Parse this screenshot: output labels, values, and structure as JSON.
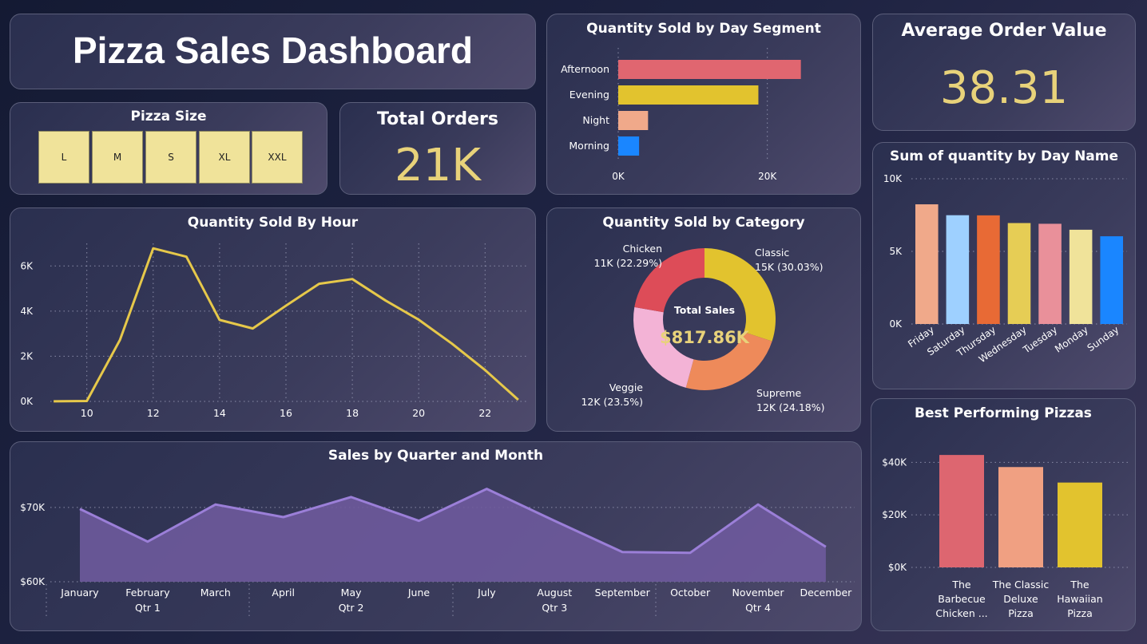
{
  "title": "Pizza Sales Dashboard",
  "colors": {
    "yellow": "#e6c84a",
    "purple": "#9b7fd8",
    "kpi": "#e8d27a"
  },
  "pizza_size": {
    "title": "Pizza Size",
    "options": [
      "L",
      "M",
      "S",
      "XL",
      "XXL"
    ]
  },
  "total_orders": {
    "title": "Total Orders",
    "value": "21K"
  },
  "avg_order": {
    "title": "Average Order Value",
    "value": "38.31"
  },
  "chart_data": [
    {
      "id": "day_segment",
      "type": "bar",
      "orientation": "horizontal",
      "title": "Quantity Sold by Day Segment",
      "categories": [
        "Afternoon",
        "Evening",
        "Night",
        "Morning"
      ],
      "values": [
        24500,
        18800,
        4000,
        2800
      ],
      "colors": [
        "#e06670",
        "#e2c32e",
        "#f0a98a",
        "#1a86ff"
      ],
      "xlim": [
        0,
        30000
      ],
      "ticks": [
        0,
        20000
      ],
      "tick_labels": [
        "0K",
        "20K"
      ],
      "grid": true
    },
    {
      "id": "by_hour",
      "type": "line",
      "title": "Quantity Sold By Hour",
      "x": [
        9,
        10,
        11,
        12,
        13,
        14,
        15,
        16,
        17,
        18,
        19,
        20,
        21,
        22,
        23
      ],
      "values": [
        4,
        18,
        2730,
        6780,
        6410,
        3610,
        3230,
        4240,
        5210,
        5420,
        4470,
        3620,
        2560,
        1390,
        70
      ],
      "xlim": [
        8.9,
        23.1
      ],
      "ylim": [
        0,
        7000
      ],
      "xticks": [
        10,
        12,
        14,
        16,
        18,
        20,
        22
      ],
      "yticks": [
        0,
        2000,
        4000,
        6000
      ],
      "ytick_labels": [
        "0K",
        "2K",
        "4K",
        "6K"
      ],
      "grid": true
    },
    {
      "id": "category",
      "type": "pie",
      "title": "Quantity Sold by Category",
      "center_label": "Total Sales",
      "center_value": "$817.86K",
      "slices": [
        {
          "name": "Classic",
          "value": 30.03,
          "label": "15K (30.03%)",
          "color": "#e2c32e"
        },
        {
          "name": "Supreme",
          "value": 24.18,
          "label": "12K (24.18%)",
          "color": "#ee8a5a"
        },
        {
          "name": "Veggie",
          "value": 23.5,
          "label": "12K (23.5%)",
          "color": "#f3b3d6"
        },
        {
          "name": "Chicken",
          "value": 22.29,
          "label": "11K (22.29%)",
          "color": "#dd4c58"
        }
      ]
    },
    {
      "id": "day_name",
      "type": "bar",
      "title": "Sum of quantity by Day Name",
      "categories": [
        "Friday",
        "Saturday",
        "Thursday",
        "Wednesday",
        "Tuesday",
        "Monday",
        "Sunday"
      ],
      "values": [
        8240,
        7490,
        7480,
        6950,
        6900,
        6490,
        6040
      ],
      "colors": [
        "#f0a98a",
        "#9ed0ff",
        "#e86a35",
        "#e6cd55",
        "#e9909a",
        "#f0e39a",
        "#1a86ff"
      ],
      "ylim": [
        0,
        10000
      ],
      "yticks": [
        0,
        5000,
        10000
      ],
      "ytick_labels": [
        "0K",
        "5K",
        "10K"
      ],
      "grid": true
    },
    {
      "id": "best_pizzas",
      "type": "bar",
      "title": "Best Performing Pizzas",
      "categories": [
        "The Barbecue Chicken ...",
        "The Classic Deluxe Pizza",
        "The Hawaiian Pizza"
      ],
      "category_lines": [
        [
          "The",
          "Barbecue",
          "Chicken ..."
        ],
        [
          "The Classic",
          "Deluxe",
          "Pizza"
        ],
        [
          "The",
          "Hawaiian",
          "Pizza"
        ]
      ],
      "values": [
        42800,
        38200,
        32300
      ],
      "colors": [
        "#dd6670",
        "#f0a082",
        "#e2c32e"
      ],
      "ylim": [
        0,
        48000
      ],
      "yticks": [
        0,
        20000,
        40000
      ],
      "ytick_labels": [
        "$0K",
        "$20K",
        "$40K"
      ],
      "grid": true
    },
    {
      "id": "quarter_month",
      "type": "area",
      "title": "Sales by Quarter and Month",
      "categories": [
        "January",
        "February",
        "March",
        "April",
        "May",
        "June",
        "July",
        "August",
        "September",
        "October",
        "November",
        "December"
      ],
      "values": [
        69800,
        65400,
        70400,
        68700,
        71400,
        68200,
        72500,
        68200,
        64000,
        63900,
        70400,
        64700
      ],
      "quarters": [
        "Qtr 1",
        "Qtr 2",
        "Qtr 3",
        "Qtr 4"
      ],
      "ylim": [
        60000,
        74500
      ],
      "yticks": [
        60000,
        70000
      ],
      "ytick_labels": [
        "$60K",
        "$70K"
      ],
      "grid": true
    }
  ]
}
